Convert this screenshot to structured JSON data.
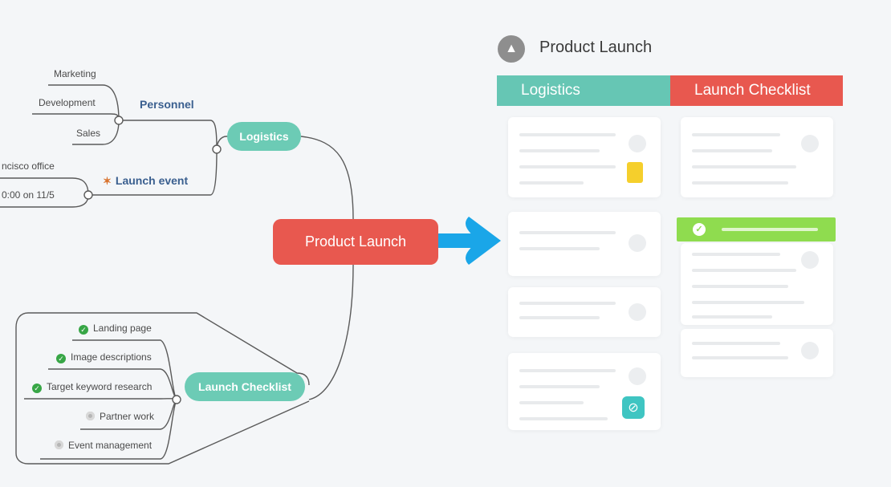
{
  "map": {
    "center": "Product Launch",
    "logistics": {
      "label": "Logistics",
      "personnel": {
        "label": "Personnel",
        "items": [
          "Marketing",
          "Development",
          "Sales"
        ]
      },
      "launch_event": {
        "icon": "party-popper-icon",
        "label": "Launch event",
        "items": [
          "ncisco office",
          "0:00 on 11/5"
        ]
      }
    },
    "checklist": {
      "label": "Launch Checklist",
      "items": [
        {
          "label": "Landing page",
          "status": "done"
        },
        {
          "label": "Image descriptions",
          "status": "done"
        },
        {
          "label": "Target keyword research",
          "status": "done"
        },
        {
          "label": "Partner work",
          "status": "pending"
        },
        {
          "label": "Event management",
          "status": "pending"
        }
      ]
    }
  },
  "board": {
    "logo_icon": "rocket-icon",
    "title": "Product Launch",
    "columns": [
      {
        "label": "Logistics",
        "color": "#66c6b4"
      },
      {
        "label": "Launch Checklist",
        "color": "#e8584f"
      }
    ],
    "attachment_icons": [
      "document-icon",
      "link-icon"
    ],
    "done_badge_icon": "check-icon"
  },
  "colors": {
    "teal": "#6ccbb5",
    "red": "#e8584f",
    "arrow": "#1aa6e8",
    "done_green": "#8fdc4f",
    "yellow_doc": "#f5cf2c"
  }
}
